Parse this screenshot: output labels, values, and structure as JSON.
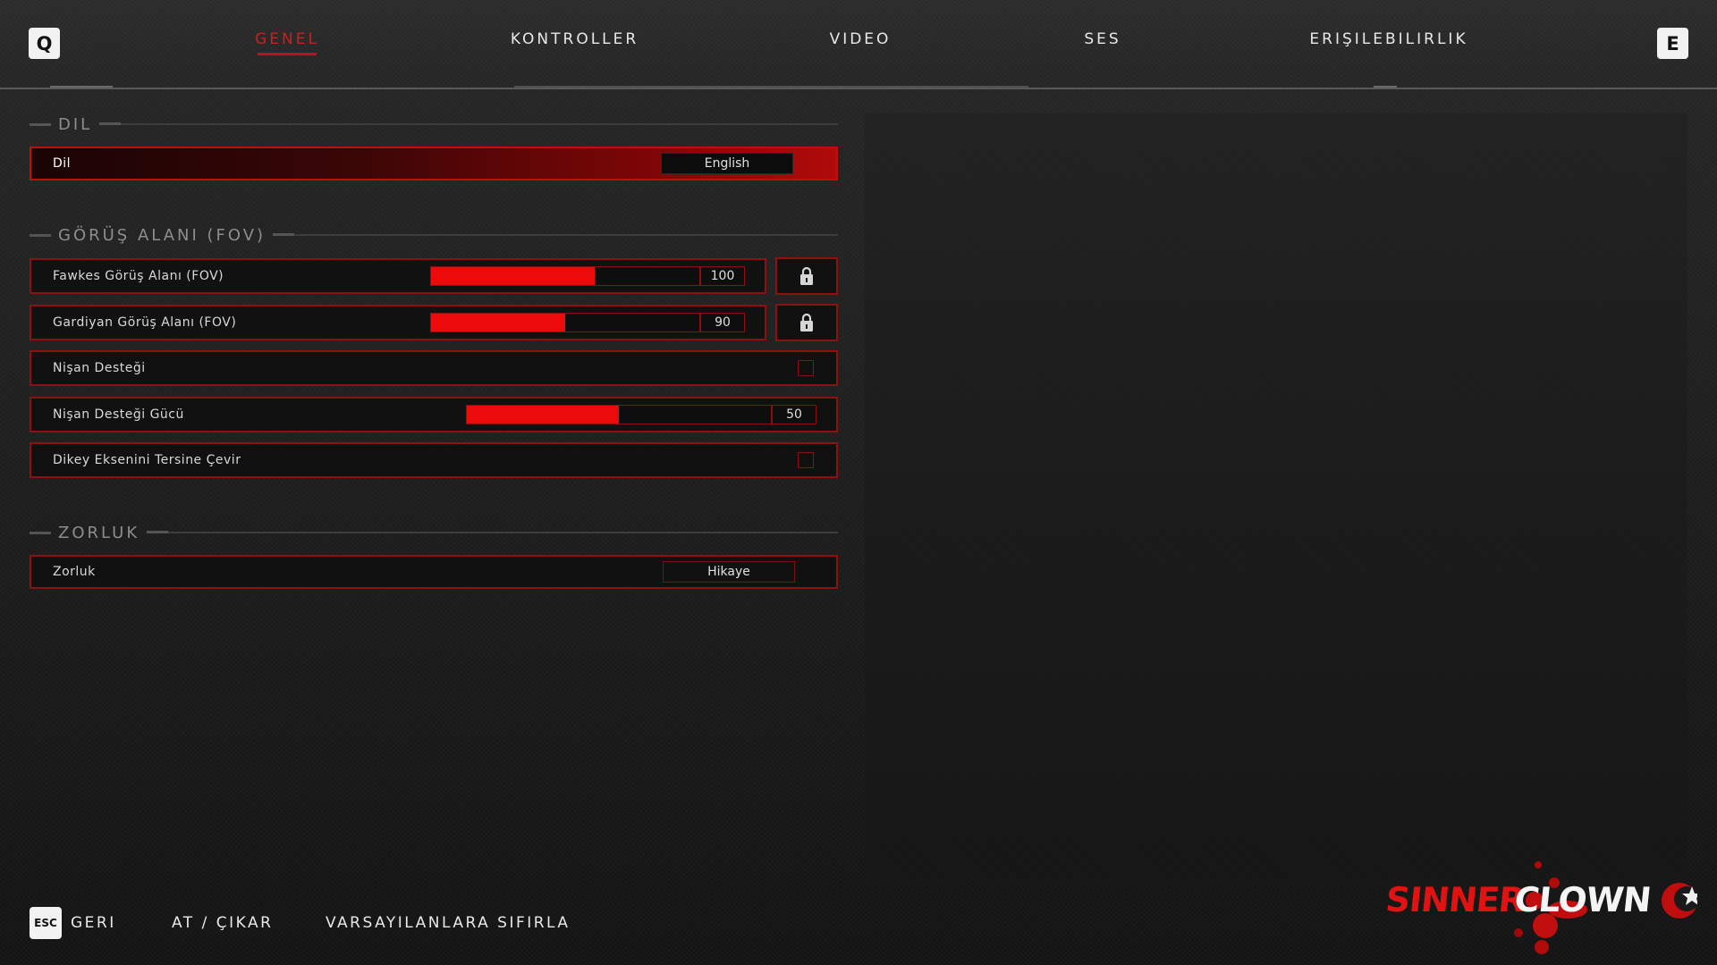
{
  "nav": {
    "left_key": "Q",
    "right_key": "E",
    "tabs": [
      {
        "label": "GENEL",
        "active": true
      },
      {
        "label": "KONTROLLER",
        "active": false
      },
      {
        "label": "VIDEO",
        "active": false
      },
      {
        "label": "SES",
        "active": false
      },
      {
        "label": "ERIŞILEBILIRLIK",
        "active": false
      }
    ]
  },
  "sections": {
    "language": {
      "title": "DIL",
      "row": {
        "label": "Dil",
        "value": "English"
      }
    },
    "fov": {
      "title": "GÖRÜŞ ALANI (FOV)",
      "rows": [
        {
          "label": "Fawkes Görüş Alanı (FOV)",
          "value": "100",
          "level": 0.61,
          "locked": true
        },
        {
          "label": "Gardiyan Görüş Alanı (FOV)",
          "value": "90",
          "level": 0.5,
          "locked": true
        },
        {
          "label": "Nişan Desteği",
          "checked": false
        },
        {
          "label": "Nişan Desteği Gücü",
          "value": "50",
          "level": 0.5
        },
        {
          "label": "Dikey Eksenini Tersine Çevir",
          "checked": false
        }
      ]
    },
    "difficulty": {
      "title": "ZORLUK",
      "row": {
        "label": "Zorluk",
        "value": "Hikaye"
      }
    }
  },
  "footer": {
    "esc_key": "ESC",
    "back": "GERI",
    "kick": "AT / ÇIKAR",
    "reset": "VARSAYILANLARA SIFIRLA"
  },
  "logo": {
    "text_red": "SINNER",
    "text_white": "CLOWN"
  },
  "colors": {
    "accent": "#ec0a0a",
    "border": "#8e1010",
    "active_tab": "#d21d1d"
  }
}
